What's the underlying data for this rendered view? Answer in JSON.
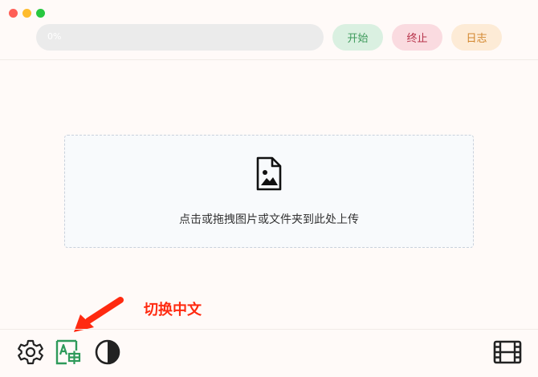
{
  "progress": {
    "text": "0%",
    "value": 0
  },
  "toolbar": {
    "start_label": "开始",
    "stop_label": "终止",
    "log_label": "日志"
  },
  "dropzone": {
    "icon": "image-file-icon",
    "text": "点击或拖拽图片或文件夹到此处上传"
  },
  "annotation": {
    "hint_text": "切换中文",
    "color": "#ff2a10"
  },
  "bottom_bar": {
    "icons": [
      "settings-gear-icon",
      "language-switch-icon",
      "theme-contrast-icon",
      "film-icon"
    ]
  },
  "colors": {
    "start": "#3f9a5c",
    "stop": "#b7334a",
    "log": "#d2862d"
  }
}
